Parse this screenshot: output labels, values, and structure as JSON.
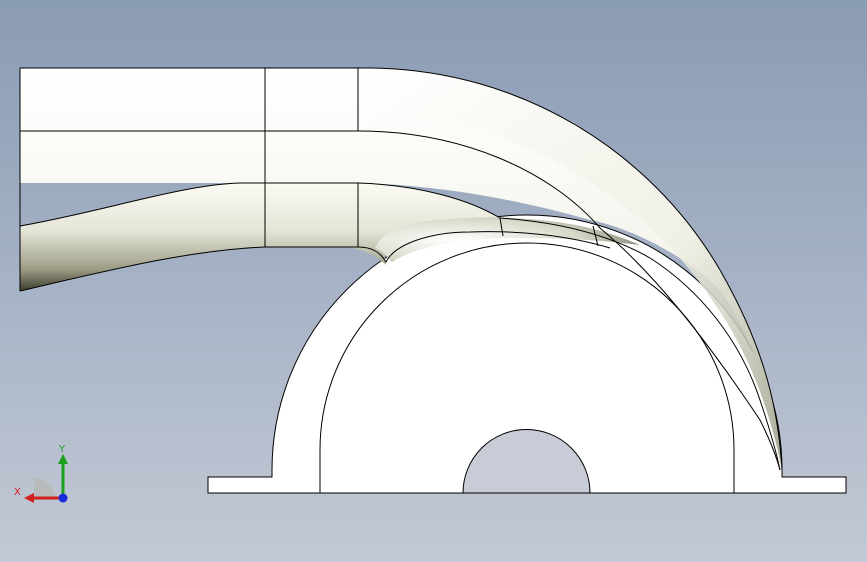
{
  "viewport": {
    "background_top": "#8a9bb4",
    "background_bottom": "#c3c9d5"
  },
  "model": {
    "fill": "#ffffff",
    "edge_color": "#000000",
    "shade_dark": "#3c3c2c",
    "shade_light": "#f6f6ee"
  },
  "triad": {
    "x_label": "X",
    "y_label": "Y",
    "x_color": "#d42020",
    "y_color": "#1aa01a",
    "z_color": "#1a2ad8"
  }
}
